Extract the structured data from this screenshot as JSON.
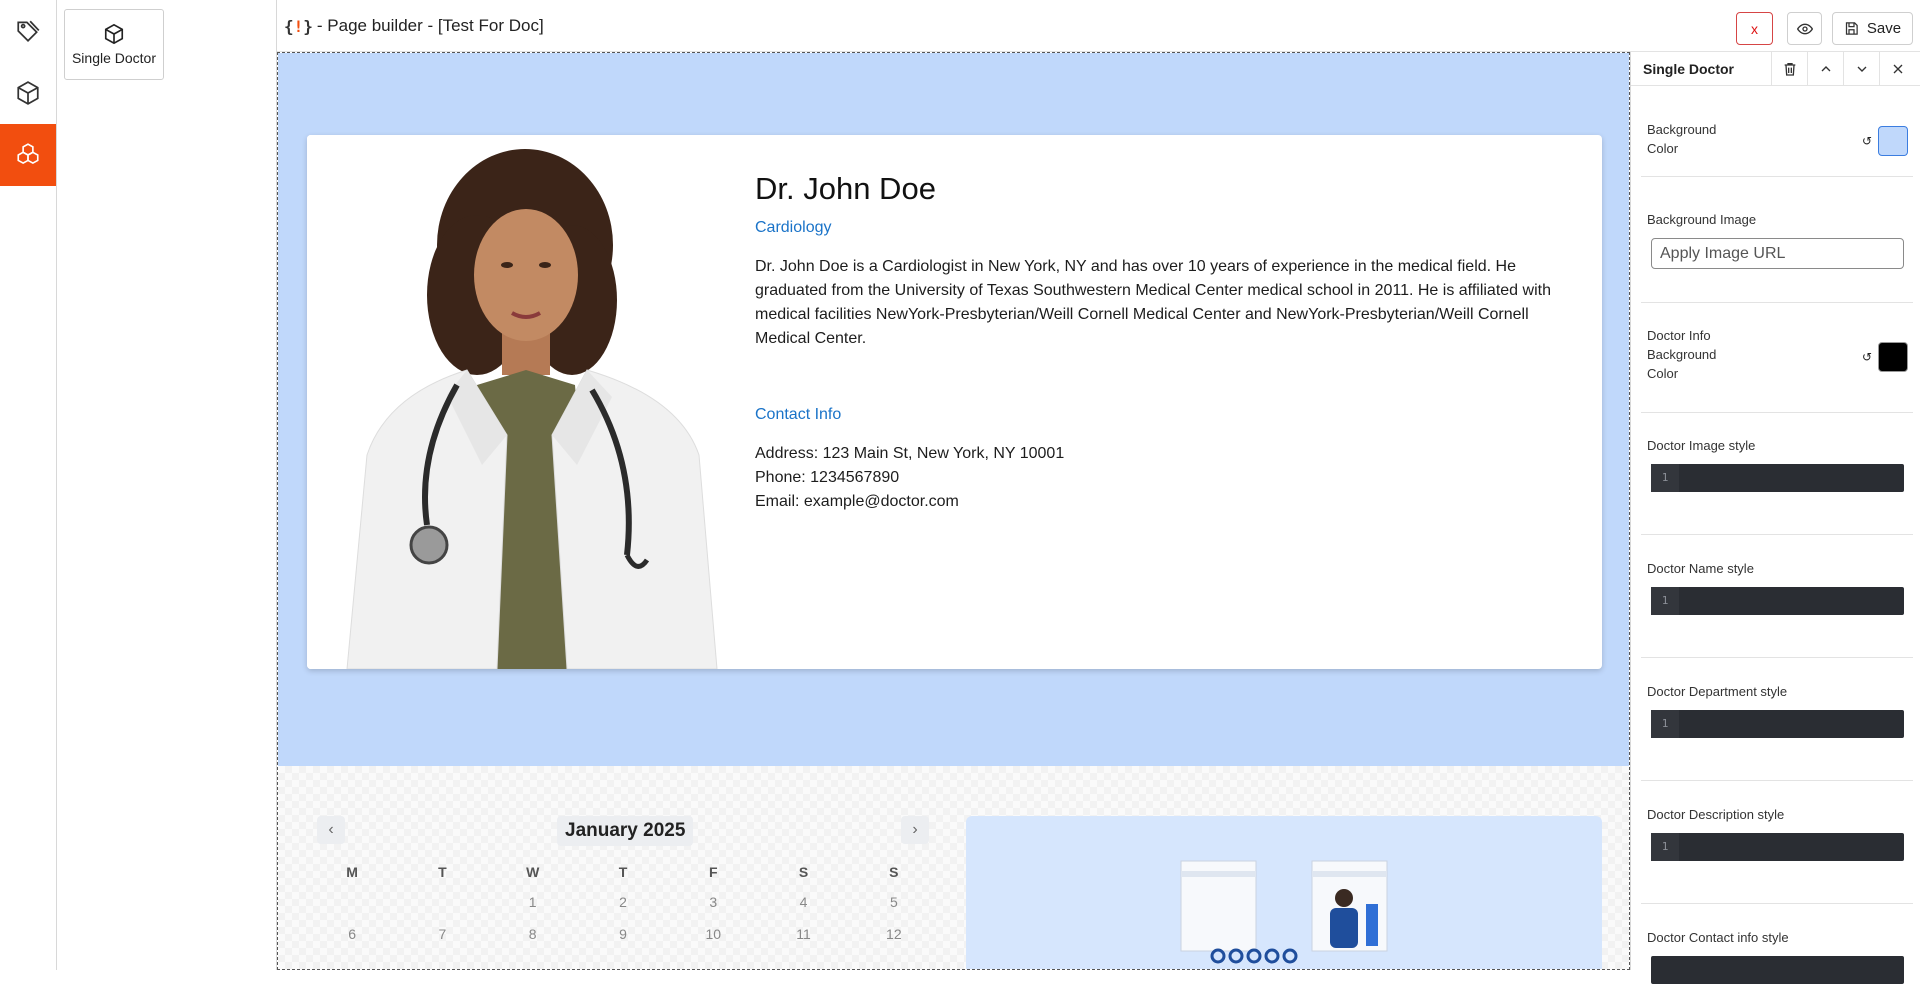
{
  "rail": {
    "items": [
      {
        "icon": "tag-icon",
        "active": false
      },
      {
        "icon": "cube-icon",
        "active": false
      },
      {
        "icon": "blocks-icon",
        "active": true
      }
    ]
  },
  "blocks": {
    "items": [
      {
        "label": "Single Doctor",
        "icon": "cube-icon"
      }
    ]
  },
  "topbar": {
    "title": "- Page builder - [Test For Doc]",
    "close_label": "x",
    "save_label": "Save"
  },
  "doctor": {
    "name": "Dr. John Doe",
    "department": "Cardiology",
    "description": "Dr. John Doe is a Cardiologist in New York, NY and has over 10 years of experience in the medical field. He graduated from the University of Texas Southwestern Medical Center medical school in 2011. He is affiliated with medical facilities NewYork-Presbyterian/Weill Cornell Medical Center and NewYork-Presbyterian/Weill Cornell Medical Center.",
    "contact_heading": "Contact Info",
    "address": "Address: 123 Main St, New York, NY 10001",
    "phone": "Phone: 1234567890",
    "email": "Email: example@doctor.com"
  },
  "calendar": {
    "month": "January 2025",
    "weekdays": [
      "M",
      "T",
      "W",
      "T",
      "F",
      "S",
      "S"
    ],
    "days": [
      "",
      "",
      "1",
      "2",
      "3",
      "4",
      "5",
      "6",
      "7",
      "8",
      "9",
      "10",
      "11",
      "12"
    ]
  },
  "props": {
    "title": "Single Doctor",
    "bg_color_label": "Background Color",
    "bg_color": "#c0d8fb",
    "bg_image_label": "Background Image",
    "bg_image_placeholder": "Apply Image URL",
    "info_bg_label": "Doctor Info Background Color",
    "info_bg_color": "#000000",
    "reset_symbol": "↺",
    "code_line": "1",
    "style_fields": [
      "Doctor Image style",
      "Doctor Name style",
      "Doctor Department style",
      "Doctor Description style",
      "Doctor Contact info style"
    ]
  },
  "colors": {
    "accent": "#f24e0f",
    "link": "#1a73c8",
    "hero_bg": "#c0d8fb",
    "illustration_bg": "#d6e6fd"
  }
}
